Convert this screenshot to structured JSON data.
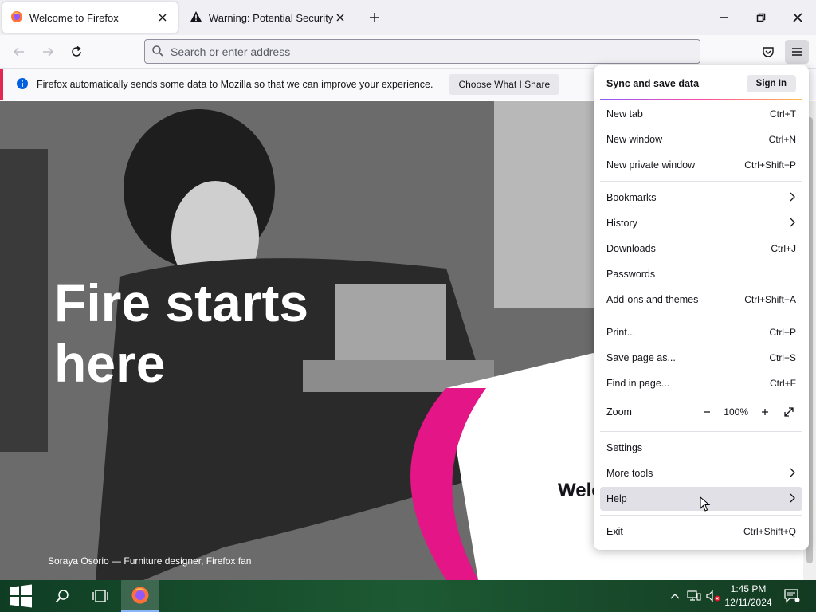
{
  "browser": {
    "tabs": [
      {
        "label": "Welcome to Firefox",
        "icon": "firefox-icon",
        "active": true
      },
      {
        "label": "Warning: Potential Security Risk",
        "icon": "warning-icon",
        "active": false
      }
    ]
  },
  "navbar": {
    "url_placeholder": "Search or enter address"
  },
  "notification": {
    "message": "Firefox automatically sends some data to Mozilla so that we can improve your experience.",
    "button": "Choose What I Share"
  },
  "page": {
    "hero_title": "Fire starts here",
    "caption": "Soraya Osorio — Furniture designer, Firefox fan",
    "welcome_partial": "Welc"
  },
  "menu": {
    "sync_label": "Sync and save data",
    "sign_in": "Sign In",
    "items": [
      {
        "label": "New tab",
        "shortcut": "Ctrl+T"
      },
      {
        "label": "New window",
        "shortcut": "Ctrl+N"
      },
      {
        "label": "New private window",
        "shortcut": "Ctrl+Shift+P"
      },
      {
        "label": "Bookmarks",
        "submenu": true
      },
      {
        "label": "History",
        "submenu": true
      },
      {
        "label": "Downloads",
        "shortcut": "Ctrl+J"
      },
      {
        "label": "Passwords"
      },
      {
        "label": "Add-ons and themes",
        "shortcut": "Ctrl+Shift+A"
      },
      {
        "label": "Print...",
        "shortcut": "Ctrl+P"
      },
      {
        "label": "Save page as...",
        "shortcut": "Ctrl+S"
      },
      {
        "label": "Find in page...",
        "shortcut": "Ctrl+F"
      },
      {
        "label": "Settings"
      },
      {
        "label": "More tools",
        "submenu": true
      },
      {
        "label": "Help",
        "submenu": true,
        "hovered": true
      },
      {
        "label": "Exit",
        "shortcut": "Ctrl+Shift+Q"
      }
    ],
    "zoom": {
      "label": "Zoom",
      "value": "100%"
    }
  },
  "taskbar": {
    "time": "1:45 PM",
    "date": "12/11/2024"
  },
  "colors": {
    "accent_pink": "#e22850",
    "menu_hover": "#e0e0e6"
  }
}
